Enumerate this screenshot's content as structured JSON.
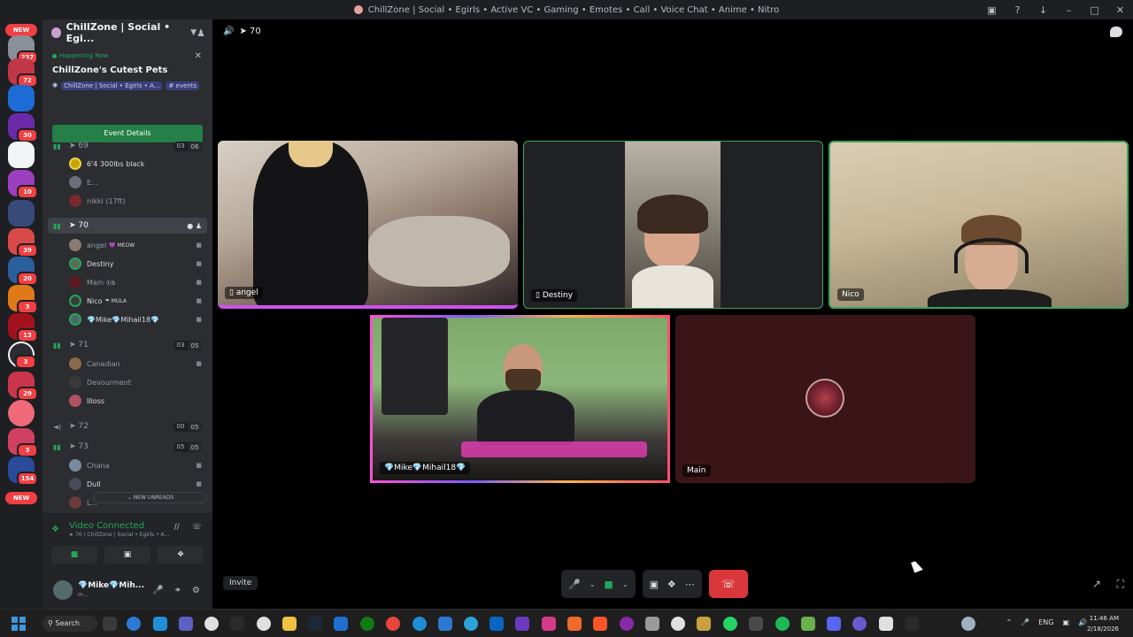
{
  "window": {
    "title": "ChillZone | Social • Egirls • Active VC • Gaming • Emotes • Call • Voice Chat • Anime • Nitro"
  },
  "guilds": {
    "new_top": "NEW",
    "new_bottom": "NEW",
    "badges": [
      "237",
      "72",
      "30",
      "10",
      "39",
      "20",
      "3",
      "13",
      "3",
      "29",
      "3",
      "154"
    ]
  },
  "server": {
    "name": "ChillZone | Social • Egi..."
  },
  "event": {
    "status": "Happening Now",
    "title": "ChillZone's Cutest Pets",
    "location": "ChillZone | Social • Egirls • A...",
    "channel": "events",
    "button": "Event Details"
  },
  "channels": [
    {
      "name": "69",
      "count_a": "03",
      "count_b": "06"
    },
    {
      "name": "70"
    },
    {
      "name": "71",
      "count_a": "03",
      "count_b": "05"
    },
    {
      "name": "72",
      "count_a": "00",
      "count_b": "05"
    },
    {
      "name": "73",
      "count_a": "05",
      "count_b": "05"
    }
  ],
  "ch69_users": [
    "6'4 300lbs black",
    "E...",
    "nikki (17ft)"
  ],
  "ch70_users": [
    {
      "name": "angel",
      "tag": "💜 MEOW"
    },
    {
      "name": "Destiny",
      "tag": ""
    },
    {
      "name": "Main",
      "tag": "ⓁS"
    },
    {
      "name": "Nico",
      "tag": "☂ MULA"
    },
    {
      "name": "💎Mike💎Mihail18💎",
      "tag": ""
    }
  ],
  "ch71_users": [
    "Canadian",
    "Devourment",
    "Illoss"
  ],
  "ch73_users": [
    "Chana",
    "Dull",
    "L..."
  ],
  "new_unreads": "NEW UNREADS",
  "voice": {
    "status": "Video Connected",
    "sub": "70 / ChillZone | Social • Egirls • A...",
    "user_name": "💎Mike💎Mih...",
    "user_status": "m..."
  },
  "stage": {
    "channel": "70",
    "invite": "Invite",
    "tiles": {
      "angel": "angel",
      "destiny": "Destiny",
      "nico": "Nico",
      "mike": "💎Mike💎Mihail18💎",
      "main": "Main"
    }
  },
  "taskbar": {
    "search": "Search",
    "lang": "ENG",
    "time": "11:46 AM",
    "date": "2/18/2026"
  },
  "colors": {
    "accent_green": "#23a55a",
    "end_call": "#da373c",
    "sidebar": "#2b2d31",
    "guild_rail": "#1e1f22"
  }
}
